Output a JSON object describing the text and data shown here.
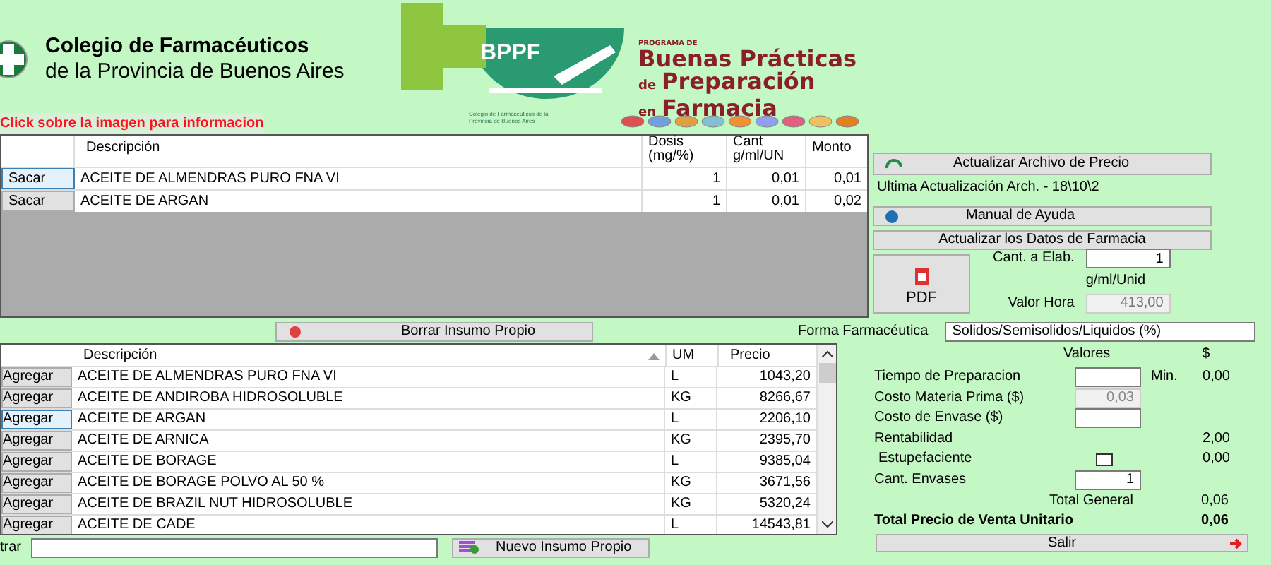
{
  "header": {
    "org_line_1": "Colegio de Farmacéuticos",
    "org_line_2": "de la Provincia de Buenos Aires",
    "badge": "BPPF",
    "program_label": "PROGRAMA DE",
    "program_title_1": "Buenas Prácticas",
    "program_title_2_prefix": "de",
    "program_title_2": "Preparación",
    "program_title_3_prefix": "en",
    "program_title_3": "Farmacia",
    "info_link": "Click sobre la imagen para informacion",
    "caption_1": "Colegio de Farmacéuticos",
    "caption_2": "de la Provincia de Buenos Aires"
  },
  "selected_table": {
    "columns": [
      "Descripción",
      "Dosis (mg/%)",
      "Cant g/ml/UN",
      "Monto"
    ],
    "rows": [
      {
        "action": "Sacar",
        "description": "ACEITE DE ALMENDRAS PURO FNA VI",
        "dose": "1",
        "amount": "0,01",
        "total": "0,01",
        "selected": true
      },
      {
        "action": "Sacar",
        "description": "ACEITE DE ARGAN",
        "dose": "1",
        "amount": "0,01",
        "total": "0,02",
        "selected": false
      }
    ]
  },
  "delete_button": "Borrar Insumo Propio",
  "form": {
    "label": "Forma Farmacéutica",
    "value": "Solidos/Semisolidos/Liquidos (%)"
  },
  "catalog_table": {
    "columns": [
      "Descripción",
      "UM",
      "Precio"
    ],
    "rows": [
      {
        "action": "Agregar",
        "description": "ACEITE DE ALMENDRAS PURO FNA VI",
        "unit": "L",
        "price": "1043,20",
        "selected": false
      },
      {
        "action": "Agregar",
        "description": "ACEITE DE ANDIROBA HIDROSOLUBLE",
        "unit": "KG",
        "price": "8266,67",
        "selected": false
      },
      {
        "action": "Agregar",
        "description": "ACEITE DE ARGAN",
        "unit": "L",
        "price": "2206,10",
        "selected": true
      },
      {
        "action": "Agregar",
        "description": "ACEITE DE ARNICA",
        "unit": "KG",
        "price": "2395,70",
        "selected": false
      },
      {
        "action": "Agregar",
        "description": "ACEITE DE BORAGE",
        "unit": "L",
        "price": "9385,04",
        "selected": false
      },
      {
        "action": "Agregar",
        "description": "ACEITE DE BORAGE POLVO AL 50 %",
        "unit": "KG",
        "price": "3671,56",
        "selected": false
      },
      {
        "action": "Agregar",
        "description": "ACEITE DE BRAZIL NUT HIDROSOLUBLE",
        "unit": "KG",
        "price": "5320,24",
        "selected": false
      },
      {
        "action": "Agregar",
        "description": "ACEITE DE CADE",
        "unit": "L",
        "price": "14543,81",
        "selected": false
      }
    ]
  },
  "filter": {
    "label": "trar"
  },
  "new_button": "Nuevo Insumo Propio",
  "side": {
    "update_prices_button": "Actualizar Archivo de Precio",
    "last_update": "Ultima Actualización Arch. - 18\\10\\2",
    "help_button": "Manual de Ayuda",
    "update_pharmacy_button": "Actualizar los Datos de Farmacia",
    "pdf_button": "PDF",
    "quantity_label": "Cant. a Elab.",
    "quantity_value": "1",
    "quantity_unit": "g/ml/Unid",
    "hour_label": "Valor Hora",
    "hour_value": "413,00"
  },
  "calc": {
    "values_header": "Valores",
    "currency_header": "$",
    "rows": [
      {
        "kind": "input",
        "label": "Tiempo de Preparacion",
        "unit": "Min.",
        "amount": "0,00"
      },
      {
        "kind": "readonly",
        "label": "Costo Materia Prima ($)",
        "value": "0,03"
      },
      {
        "kind": "input",
        "label": "Costo de Envase ($)"
      },
      {
        "kind": "plain",
        "label": "Rentabilidad",
        "amount": "2,00"
      },
      {
        "kind": "checkbox",
        "label": "Estupefaciente",
        "checked": false,
        "amount": "0,00"
      },
      {
        "kind": "input",
        "label": "Cant. Envases",
        "value": "1"
      }
    ],
    "total_label": "Total General",
    "total": "0,06",
    "unit_total_label": "Total Precio de Venta Unitario",
    "unit_total": "0,06",
    "exit_button": "Salir"
  }
}
